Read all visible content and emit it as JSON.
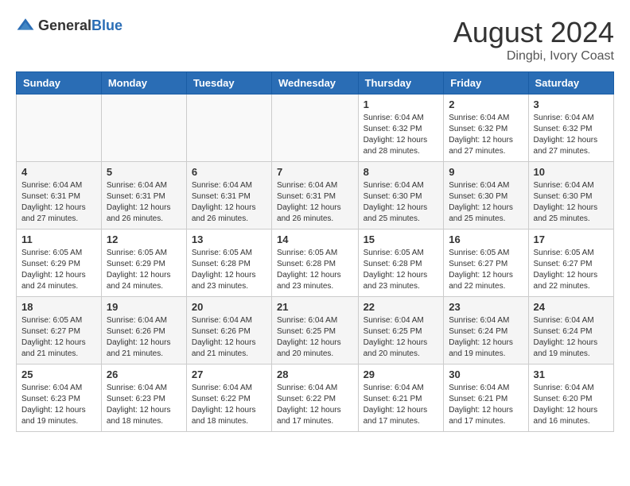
{
  "header": {
    "logo_general": "General",
    "logo_blue": "Blue",
    "month_year": "August 2024",
    "location": "Dingbi, Ivory Coast"
  },
  "weekdays": [
    "Sunday",
    "Monday",
    "Tuesday",
    "Wednesday",
    "Thursday",
    "Friday",
    "Saturday"
  ],
  "weeks": [
    [
      {
        "day": "",
        "info": ""
      },
      {
        "day": "",
        "info": ""
      },
      {
        "day": "",
        "info": ""
      },
      {
        "day": "",
        "info": ""
      },
      {
        "day": "1",
        "info": "Sunrise: 6:04 AM\nSunset: 6:32 PM\nDaylight: 12 hours\nand 28 minutes."
      },
      {
        "day": "2",
        "info": "Sunrise: 6:04 AM\nSunset: 6:32 PM\nDaylight: 12 hours\nand 27 minutes."
      },
      {
        "day": "3",
        "info": "Sunrise: 6:04 AM\nSunset: 6:32 PM\nDaylight: 12 hours\nand 27 minutes."
      }
    ],
    [
      {
        "day": "4",
        "info": "Sunrise: 6:04 AM\nSunset: 6:31 PM\nDaylight: 12 hours\nand 27 minutes."
      },
      {
        "day": "5",
        "info": "Sunrise: 6:04 AM\nSunset: 6:31 PM\nDaylight: 12 hours\nand 26 minutes."
      },
      {
        "day": "6",
        "info": "Sunrise: 6:04 AM\nSunset: 6:31 PM\nDaylight: 12 hours\nand 26 minutes."
      },
      {
        "day": "7",
        "info": "Sunrise: 6:04 AM\nSunset: 6:31 PM\nDaylight: 12 hours\nand 26 minutes."
      },
      {
        "day": "8",
        "info": "Sunrise: 6:04 AM\nSunset: 6:30 PM\nDaylight: 12 hours\nand 25 minutes."
      },
      {
        "day": "9",
        "info": "Sunrise: 6:04 AM\nSunset: 6:30 PM\nDaylight: 12 hours\nand 25 minutes."
      },
      {
        "day": "10",
        "info": "Sunrise: 6:04 AM\nSunset: 6:30 PM\nDaylight: 12 hours\nand 25 minutes."
      }
    ],
    [
      {
        "day": "11",
        "info": "Sunrise: 6:05 AM\nSunset: 6:29 PM\nDaylight: 12 hours\nand 24 minutes."
      },
      {
        "day": "12",
        "info": "Sunrise: 6:05 AM\nSunset: 6:29 PM\nDaylight: 12 hours\nand 24 minutes."
      },
      {
        "day": "13",
        "info": "Sunrise: 6:05 AM\nSunset: 6:28 PM\nDaylight: 12 hours\nand 23 minutes."
      },
      {
        "day": "14",
        "info": "Sunrise: 6:05 AM\nSunset: 6:28 PM\nDaylight: 12 hours\nand 23 minutes."
      },
      {
        "day": "15",
        "info": "Sunrise: 6:05 AM\nSunset: 6:28 PM\nDaylight: 12 hours\nand 23 minutes."
      },
      {
        "day": "16",
        "info": "Sunrise: 6:05 AM\nSunset: 6:27 PM\nDaylight: 12 hours\nand 22 minutes."
      },
      {
        "day": "17",
        "info": "Sunrise: 6:05 AM\nSunset: 6:27 PM\nDaylight: 12 hours\nand 22 minutes."
      }
    ],
    [
      {
        "day": "18",
        "info": "Sunrise: 6:05 AM\nSunset: 6:27 PM\nDaylight: 12 hours\nand 21 minutes."
      },
      {
        "day": "19",
        "info": "Sunrise: 6:04 AM\nSunset: 6:26 PM\nDaylight: 12 hours\nand 21 minutes."
      },
      {
        "day": "20",
        "info": "Sunrise: 6:04 AM\nSunset: 6:26 PM\nDaylight: 12 hours\nand 21 minutes."
      },
      {
        "day": "21",
        "info": "Sunrise: 6:04 AM\nSunset: 6:25 PM\nDaylight: 12 hours\nand 20 minutes."
      },
      {
        "day": "22",
        "info": "Sunrise: 6:04 AM\nSunset: 6:25 PM\nDaylight: 12 hours\nand 20 minutes."
      },
      {
        "day": "23",
        "info": "Sunrise: 6:04 AM\nSunset: 6:24 PM\nDaylight: 12 hours\nand 19 minutes."
      },
      {
        "day": "24",
        "info": "Sunrise: 6:04 AM\nSunset: 6:24 PM\nDaylight: 12 hours\nand 19 minutes."
      }
    ],
    [
      {
        "day": "25",
        "info": "Sunrise: 6:04 AM\nSunset: 6:23 PM\nDaylight: 12 hours\nand 19 minutes."
      },
      {
        "day": "26",
        "info": "Sunrise: 6:04 AM\nSunset: 6:23 PM\nDaylight: 12 hours\nand 18 minutes."
      },
      {
        "day": "27",
        "info": "Sunrise: 6:04 AM\nSunset: 6:22 PM\nDaylight: 12 hours\nand 18 minutes."
      },
      {
        "day": "28",
        "info": "Sunrise: 6:04 AM\nSunset: 6:22 PM\nDaylight: 12 hours\nand 17 minutes."
      },
      {
        "day": "29",
        "info": "Sunrise: 6:04 AM\nSunset: 6:21 PM\nDaylight: 12 hours\nand 17 minutes."
      },
      {
        "day": "30",
        "info": "Sunrise: 6:04 AM\nSunset: 6:21 PM\nDaylight: 12 hours\nand 17 minutes."
      },
      {
        "day": "31",
        "info": "Sunrise: 6:04 AM\nSunset: 6:20 PM\nDaylight: 12 hours\nand 16 minutes."
      }
    ]
  ]
}
